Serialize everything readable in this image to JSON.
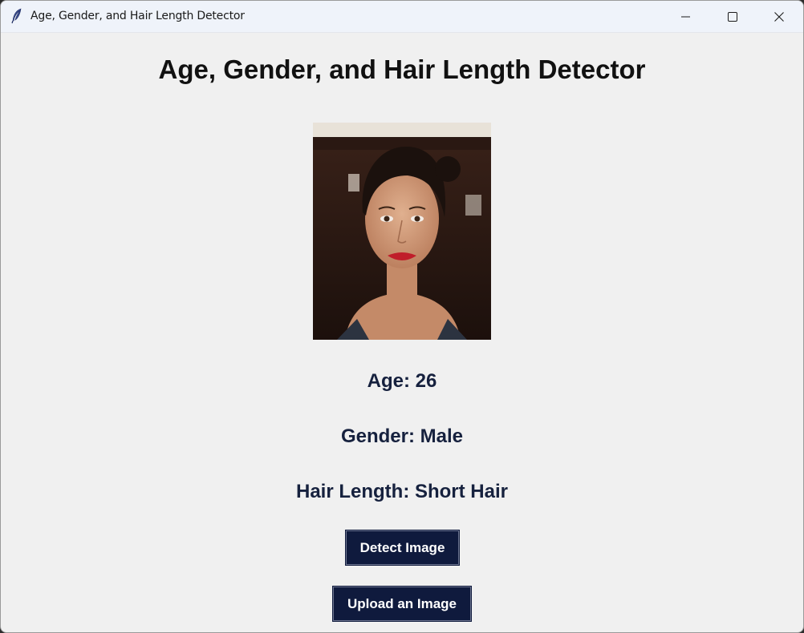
{
  "window": {
    "title": "Age, Gender, and Hair Length Detector",
    "icon": "feather-icon",
    "controls": [
      "minimize-icon",
      "maximize-icon",
      "close-icon"
    ]
  },
  "main": {
    "heading": "Age, Gender, and Hair Length Detector",
    "results": {
      "age": "Age: 26",
      "gender": "Gender: Male",
      "hair_length": "Hair Length: Short Hair"
    },
    "buttons": {
      "detect": "Detect Image",
      "upload": "Upload an Image"
    }
  },
  "colors": {
    "window_bg": "#f0f0f0",
    "titlebar_bg": "#eff3fa",
    "result_text": "#16213e",
    "button_bg": "#0f1a3d",
    "button_text": "#ffffff"
  }
}
